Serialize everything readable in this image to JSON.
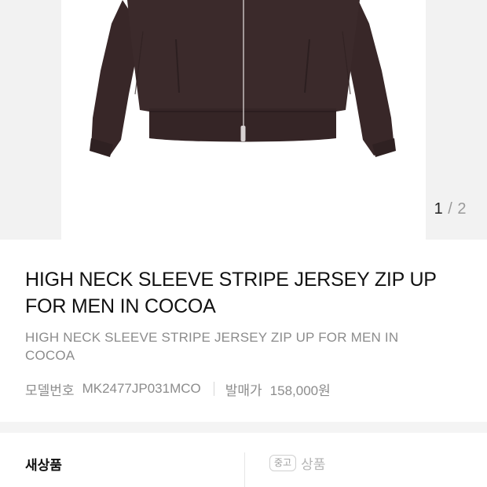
{
  "gallery": {
    "current": "1",
    "separator": "/",
    "total": "2",
    "image_icon": "zip-jacket-product-photo",
    "image_color": "#3a2a2b"
  },
  "product": {
    "title": "HIGH NECK SLEEVE STRIPE JERSEY ZIP UP FOR MEN IN COCOA",
    "subtitle": "HIGH NECK SLEEVE STRIPE JERSEY ZIP UP FOR MEN IN COCOA",
    "model_label": "모델번호",
    "model_value": "MK2477JP031MCO",
    "price_label": "발매가",
    "price_value": "158,000원"
  },
  "condition_tabs": {
    "new_label": "새상품",
    "used_badge": "중고",
    "used_label": "상품"
  }
}
